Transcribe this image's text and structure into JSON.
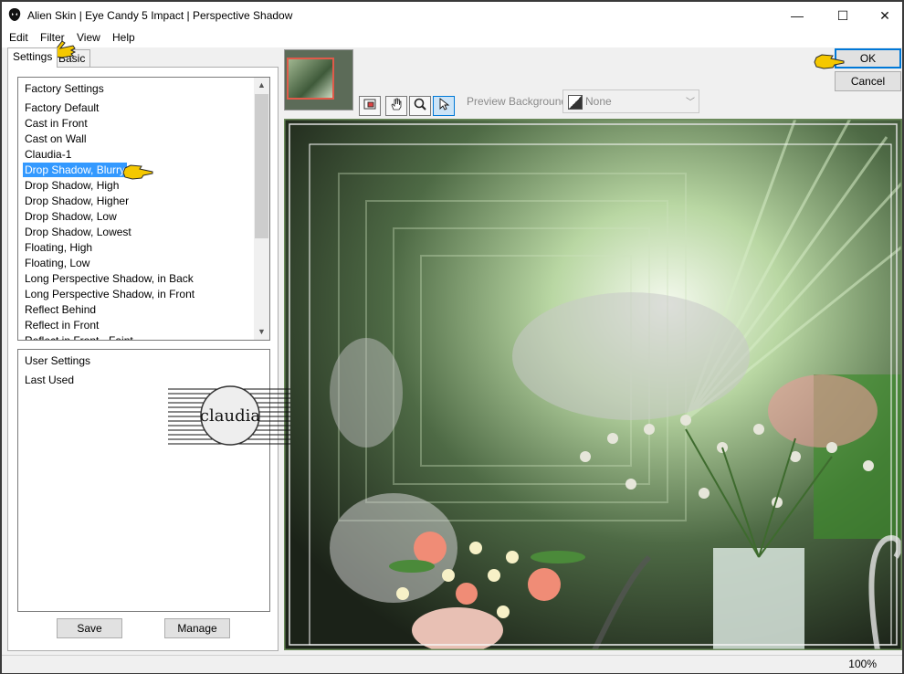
{
  "window": {
    "title": "Alien Skin | Eye Candy 5 Impact | Perspective Shadow",
    "minimize_glyph": "—",
    "maximize_glyph": "☐",
    "close_glyph": "✕"
  },
  "menu": [
    "Edit",
    "Filter",
    "View",
    "Help"
  ],
  "tabs": [
    "Settings",
    "Basic"
  ],
  "factory": {
    "header": "Factory Settings",
    "items": [
      "Factory Default",
      "Cast in Front",
      "Cast on Wall",
      "Claudia-1",
      "Drop Shadow, Blurry",
      "Drop Shadow, High",
      "Drop Shadow, Higher",
      "Drop Shadow, Low",
      "Drop Shadow, Lowest",
      "Floating, High",
      "Floating, Low",
      "Long Perspective Shadow, in Back",
      "Long Perspective Shadow, in Front",
      "Reflect Behind",
      "Reflect in Front",
      "Reflect in Front - Faint"
    ],
    "selected": "Drop Shadow, Blurry"
  },
  "user": {
    "header": "User Settings",
    "items": [
      "Last Used"
    ]
  },
  "buttons": {
    "save": "Save",
    "manage": "Manage",
    "ok": "OK",
    "cancel": "Cancel"
  },
  "preview_background": {
    "label": "Preview Background:",
    "value": "None"
  },
  "watermark": "claudia",
  "status": {
    "zoom": "100%"
  },
  "icons": {
    "app": "alien-skin-icon",
    "tools": [
      "navigator-icon",
      "hand-icon",
      "zoom-icon",
      "pointer-icon"
    ],
    "callouts": "pointing-hand-icon"
  },
  "colors": {
    "selection": "#3399ff",
    "default_button_border": "#0078d7",
    "callout": "#f5c800"
  }
}
